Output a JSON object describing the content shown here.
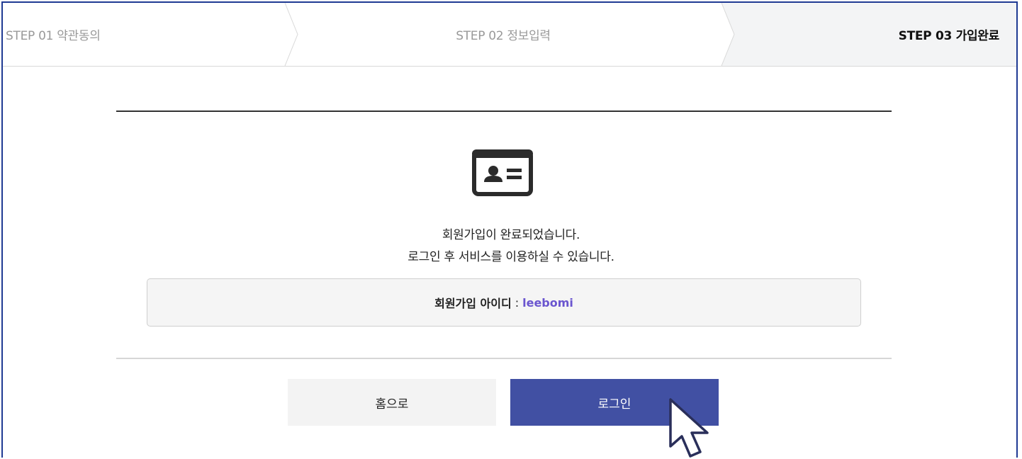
{
  "steps": [
    {
      "label": "STEP 01 약관동의",
      "state": "done"
    },
    {
      "label": "STEP 02 정보입력",
      "state": "done"
    },
    {
      "label": "STEP 03 가입완료",
      "state": "active"
    }
  ],
  "message": {
    "line1": "회원가입이 완료되었습니다.",
    "line2": "로그인 후 서비스를 이용하실 수 있습니다."
  },
  "member_id": {
    "label": "회원가입 아이디",
    "separator": ":",
    "value": "leebomi"
  },
  "buttons": {
    "home": "홈으로",
    "login": "로그인"
  },
  "icons": {
    "card": "id-card-icon",
    "cursor": "mouse-pointer-icon"
  },
  "colors": {
    "accent": "#4150a3",
    "id_value": "#6a55cf",
    "frame": "#1f3a93"
  }
}
